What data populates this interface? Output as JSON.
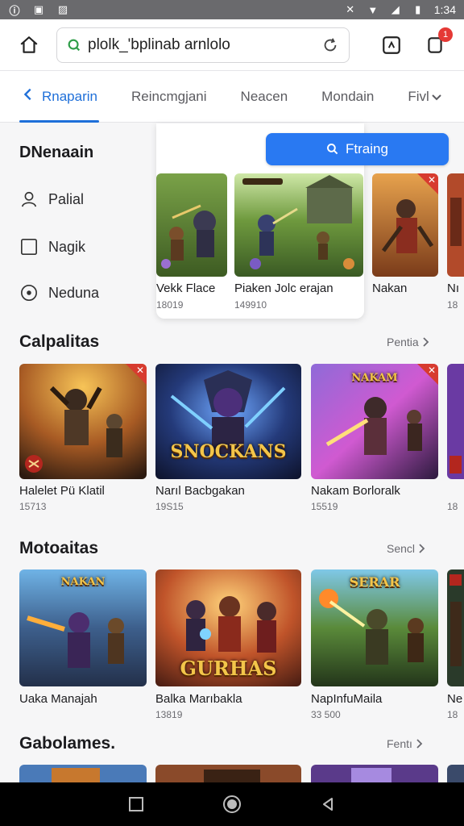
{
  "status_bar": {
    "time": "1:34",
    "left_icons": [
      "info-icon",
      "download-icon",
      "image-icon"
    ],
    "right_icons": [
      "mute-icon",
      "wifi-icon",
      "signal-icon",
      "battery-icon"
    ]
  },
  "url_bar": {
    "url": "plolk_'bplinab arnlolo",
    "icons": [
      "home-icon",
      "secure-icon",
      "reload-icon",
      "tabs-icon",
      "notification-icon"
    ],
    "notification_count": "1"
  },
  "tabs": [
    {
      "label": "Rnaparin",
      "active": true
    },
    {
      "label": "Reincmgjani",
      "active": false
    },
    {
      "label": "Neacen",
      "active": false
    },
    {
      "label": "Mondain",
      "active": false
    },
    {
      "label": "Fivl",
      "active": false
    }
  ],
  "drawer": {
    "title": "DNenaain",
    "items": [
      {
        "label": "Palial",
        "icon": "user-icon"
      },
      {
        "label": "Nagik",
        "icon": "checkbox-icon"
      },
      {
        "label": "Neduna",
        "icon": "radio-icon"
      }
    ]
  },
  "search_button": {
    "label": "Ftraing"
  },
  "featured": [
    {
      "title": "Vekk Flace",
      "sub": "18019"
    },
    {
      "title": "Piaken Jolc erajan",
      "sub": "149910"
    },
    {
      "title": "Nakan",
      "sub": ""
    },
    {
      "title": "Nı",
      "sub": "18"
    }
  ],
  "sections": [
    {
      "title": "Calpalitas",
      "see_all": "Pentia",
      "cards": [
        {
          "title": "Halelet Pü Klatil",
          "sub": "15713"
        },
        {
          "title": "Narıl Bacbgakan",
          "sub": "19S15",
          "art_text": "SNOCKANS"
        },
        {
          "title": "Nakam Borloralk",
          "sub": "15519",
          "art_text": "NAKAM"
        },
        {
          "title": "",
          "sub": "18"
        }
      ]
    },
    {
      "title": "Motoaitas",
      "see_all": "Sencl",
      "cards": [
        {
          "title": "Uaka Manajah",
          "sub": "",
          "art_text": "NAKAN"
        },
        {
          "title": "Balka Marıbakla",
          "sub": "13819",
          "art_text": "GURHAS"
        },
        {
          "title": "NapInfuMaila",
          "sub": "33 500",
          "art_text": "SERAR"
        },
        {
          "title": "Ne",
          "sub": "18"
        }
      ]
    },
    {
      "title": "Gabolames.",
      "see_all": "Fentı",
      "cards": []
    }
  ],
  "colors": {
    "accent": "#1e6fd9",
    "button": "#2979f2",
    "badge": "#e53935"
  }
}
